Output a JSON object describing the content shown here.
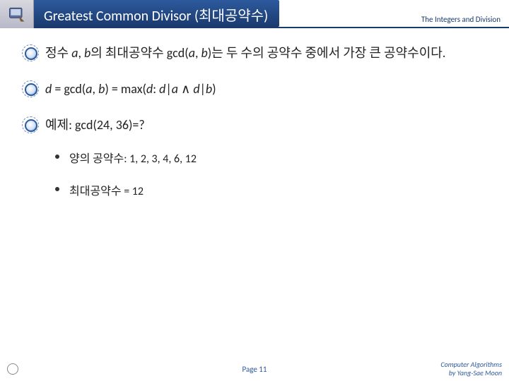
{
  "header": {
    "title": "Greatest Common Divisor (최대공약수)",
    "section": "The Integers and Division"
  },
  "bullets": {
    "b1": "정수 <span class=\"i\">a</span>, <span class=\"i\">b</span>의 최대공약수 gcd(<span class=\"i\">a</span>, <span class=\"i\">b</span>)는 두 수의 공약수 중에서 가장 큰 공약수이다.",
    "b2": "<span class=\"i\">d</span> = gcd(<span class=\"i\">a</span>, <span class=\"i\">b</span>) = max(<span class=\"i\">d</span>: <span class=\"i\">d</span>|<span class=\"i\">a</span> ∧ <span class=\"i\">d</span>|<span class=\"i\">b</span>)",
    "b3": "예제: gcd(24, 36)=?"
  },
  "subs": {
    "s1": "양의 공약수: 1, 2, 3, 4, 6, 12",
    "s2": "최대공약수 = 12"
  },
  "footer": {
    "page": "Page 11",
    "credit1": "Computer Algorithms",
    "credit2": "by Yang-Sae Moon"
  }
}
